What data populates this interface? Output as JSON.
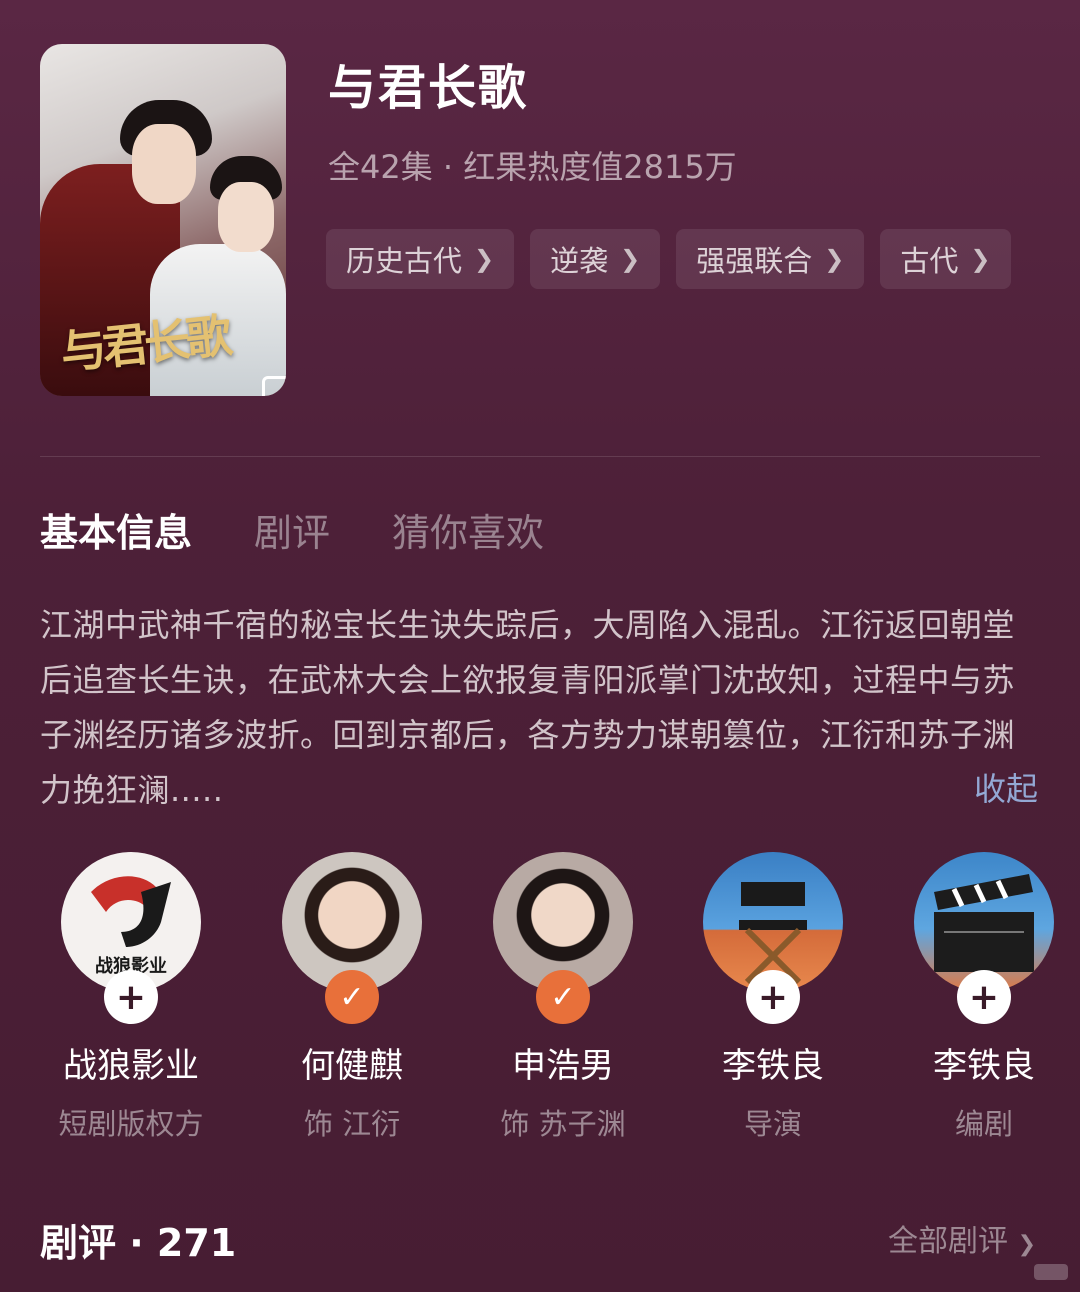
{
  "show": {
    "title": "与君长歌",
    "meta": "全42集 · 红果热度值2815万",
    "poster_title": "与君长歌",
    "tags": [
      {
        "label": "历史古代"
      },
      {
        "label": "逆袭"
      },
      {
        "label": "强强联合"
      },
      {
        "label": "古代"
      }
    ]
  },
  "tabs": [
    {
      "label": "基本信息",
      "active": true
    },
    {
      "label": "剧评",
      "active": false
    },
    {
      "label": "猜你喜欢",
      "active": false
    }
  ],
  "synopsis": {
    "text": "江湖中武神千宿的秘宝长生诀失踪后，大周陷入混乱。江衍返回朝堂后追查长生诀，在武林大会上欲报复青阳派掌门沈故知，过程中与苏子渊经历诸多波折。回到京都后，各方势力谋朝篡位，江衍和苏子渊力挽狂澜.....",
    "collapse_label": "收起"
  },
  "people": [
    {
      "name": "战狼影业",
      "role": "短剧版权方",
      "badge": "plus",
      "logo_text": "战狼影业"
    },
    {
      "name": "何健麒",
      "role": "饰 江衍",
      "badge": "check"
    },
    {
      "name": "申浩男",
      "role": "饰 苏子渊",
      "badge": "check"
    },
    {
      "name": "李铁良",
      "role": "导演",
      "badge": "plus"
    },
    {
      "name": "李铁良",
      "role": "编剧",
      "badge": "plus"
    }
  ],
  "reviews": {
    "title": "剧评 · 271",
    "all_label": "全部剧评"
  },
  "colors": {
    "background": "#4d2038",
    "accent_check": "#e8703a",
    "collapse_link": "#93a8d4"
  },
  "icons": {
    "tag_chevron": "chevron-right-icon",
    "badge_plus": "plus-icon",
    "badge_check": "check-icon",
    "poster_gallery": "gallery-icon"
  }
}
